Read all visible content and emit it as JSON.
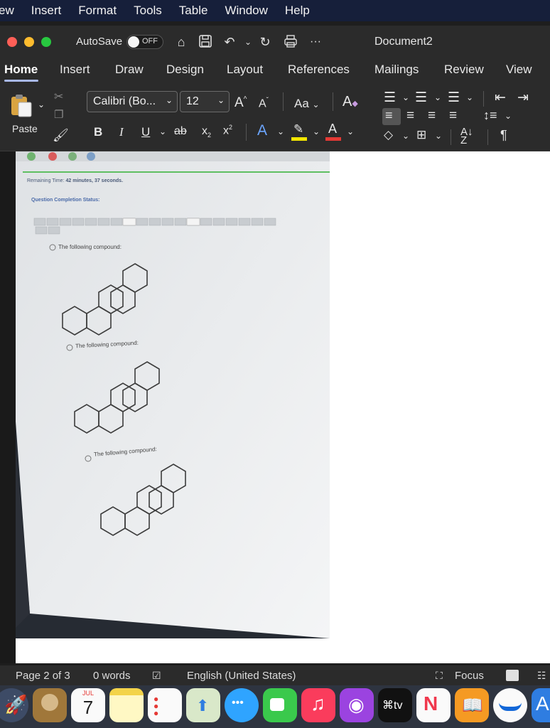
{
  "menubar": {
    "items": [
      "ew",
      "Insert",
      "Format",
      "Tools",
      "Table",
      "Window",
      "Help"
    ]
  },
  "titlebar": {
    "autosave_label": "AutoSave",
    "autosave_state": "OFF",
    "more": "···",
    "document_title": "Document2"
  },
  "tabs": [
    "Home",
    "Insert",
    "Draw",
    "Design",
    "Layout",
    "References",
    "Mailings",
    "Review",
    "View"
  ],
  "ribbon": {
    "paste_label": "Paste",
    "font_name": "Calibri (Bo...",
    "font_size": "12",
    "change_case": "Aa",
    "bold": "B",
    "italic": "I",
    "underline": "U",
    "strikethrough": "ab",
    "subscript": "x",
    "superscript": "x",
    "grow_font": "A",
    "shrink_font": "A",
    "font_color": "A",
    "text_effects": "A",
    "pilcrow": "¶"
  },
  "photo": {
    "remaining_label": "Remaining Time:",
    "remaining_value": "42 minutes, 37 seconds.",
    "status_label": "Question Completion Status:",
    "nav_numbers": [
      "1",
      "2",
      "3",
      "4",
      "5",
      "6",
      "7",
      "8",
      "9",
      "10",
      "11",
      "12",
      "13",
      "14",
      "15",
      "16",
      "17",
      "18",
      "19"
    ],
    "option_text": "The following compound:"
  },
  "statusbar": {
    "page": "Page 2 of 3",
    "words": "0 words",
    "language": "English (United States)",
    "focus": "Focus"
  },
  "dock": {
    "calendar_month": "JUL",
    "calendar_day": "7",
    "tv_label": "tv"
  },
  "colors": {
    "menubar_bg": "#161f3a",
    "chrome_bg": "#2b2b2b",
    "close": "#ff5f57",
    "minimize": "#febc2e",
    "zoom": "#28c840",
    "tab_underline": "#a8b8e8",
    "highlight_yellow": "#f2e600",
    "font_red": "#e53935"
  }
}
